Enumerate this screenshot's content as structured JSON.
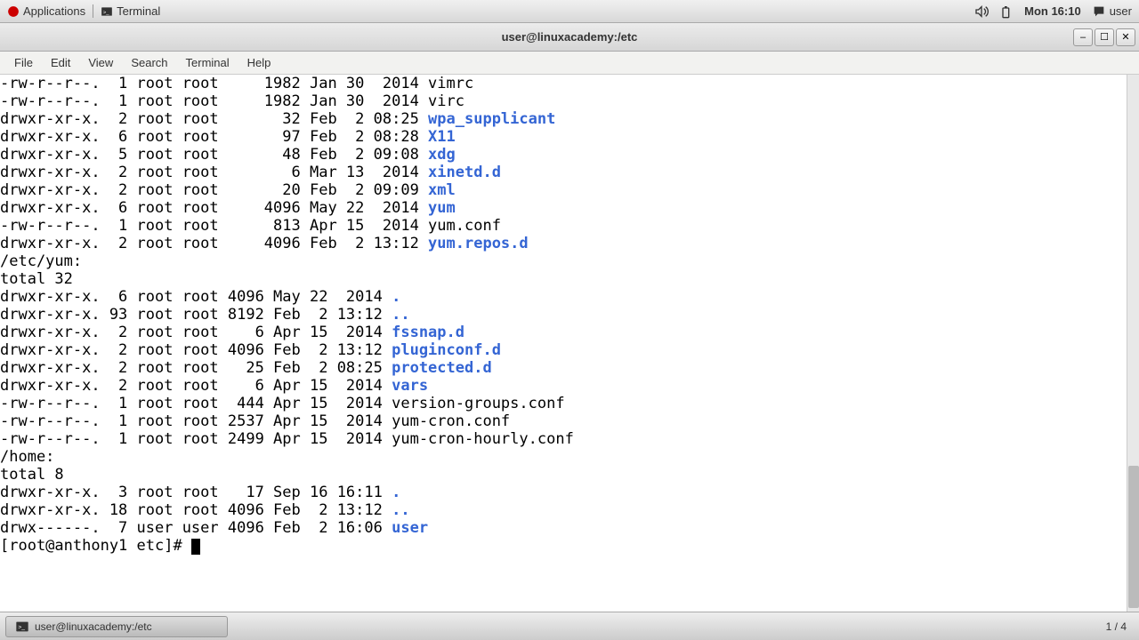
{
  "top_panel": {
    "applications": "Applications",
    "terminal_tab": "Terminal",
    "datetime": "Mon 16:10",
    "user": "user"
  },
  "window": {
    "title": "user@linuxacademy:/etc"
  },
  "menubar": {
    "file": "File",
    "edit": "Edit",
    "view": "View",
    "search": "Search",
    "terminal": "Terminal",
    "help": "Help"
  },
  "terminal_output": {
    "etc_listing": [
      {
        "pre": "-rw-r--r--.  1 root root     1982 Jan 30  2014 ",
        "name": "vimrc",
        "is_dir": false
      },
      {
        "pre": "-rw-r--r--.  1 root root     1982 Jan 30  2014 ",
        "name": "virc",
        "is_dir": false
      },
      {
        "pre": "drwxr-xr-x.  2 root root       32 Feb  2 08:25 ",
        "name": "wpa_supplicant",
        "is_dir": true
      },
      {
        "pre": "drwxr-xr-x.  6 root root       97 Feb  2 08:28 ",
        "name": "X11",
        "is_dir": true
      },
      {
        "pre": "drwxr-xr-x.  5 root root       48 Feb  2 09:08 ",
        "name": "xdg",
        "is_dir": true
      },
      {
        "pre": "drwxr-xr-x.  2 root root        6 Mar 13  2014 ",
        "name": "xinetd.d",
        "is_dir": true
      },
      {
        "pre": "drwxr-xr-x.  2 root root       20 Feb  2 09:09 ",
        "name": "xml",
        "is_dir": true
      },
      {
        "pre": "drwxr-xr-x.  6 root root     4096 May 22  2014 ",
        "name": "yum",
        "is_dir": true
      },
      {
        "pre": "-rw-r--r--.  1 root root      813 Apr 15  2014 ",
        "name": "yum.conf",
        "is_dir": false
      },
      {
        "pre": "drwxr-xr-x.  2 root root     4096 Feb  2 13:12 ",
        "name": "yum.repos.d",
        "is_dir": true
      }
    ],
    "yum_header": "/etc/yum:",
    "yum_total": "total 32",
    "yum_listing": [
      {
        "pre": "drwxr-xr-x.  6 root root 4096 May 22  2014 ",
        "name": ".",
        "is_dir": true
      },
      {
        "pre": "drwxr-xr-x. 93 root root 8192 Feb  2 13:12 ",
        "name": "..",
        "is_dir": true
      },
      {
        "pre": "drwxr-xr-x.  2 root root    6 Apr 15  2014 ",
        "name": "fssnap.d",
        "is_dir": true
      },
      {
        "pre": "drwxr-xr-x.  2 root root 4096 Feb  2 13:12 ",
        "name": "pluginconf.d",
        "is_dir": true
      },
      {
        "pre": "drwxr-xr-x.  2 root root   25 Feb  2 08:25 ",
        "name": "protected.d",
        "is_dir": true
      },
      {
        "pre": "drwxr-xr-x.  2 root root    6 Apr 15  2014 ",
        "name": "vars",
        "is_dir": true
      },
      {
        "pre": "-rw-r--r--.  1 root root  444 Apr 15  2014 ",
        "name": "version-groups.conf",
        "is_dir": false
      },
      {
        "pre": "-rw-r--r--.  1 root root 2537 Apr 15  2014 ",
        "name": "yum-cron.conf",
        "is_dir": false
      },
      {
        "pre": "-rw-r--r--.  1 root root 2499 Apr 15  2014 ",
        "name": "yum-cron-hourly.conf",
        "is_dir": false
      }
    ],
    "home_header": "/home:",
    "home_total": "total 8",
    "home_listing": [
      {
        "pre": "drwxr-xr-x.  3 root root   17 Sep 16 16:11 ",
        "name": ".",
        "is_dir": true
      },
      {
        "pre": "drwxr-xr-x. 18 root root 4096 Feb  2 13:12 ",
        "name": "..",
        "is_dir": true
      },
      {
        "pre": "drwx------.  7 user user 4096 Feb  2 16:06 ",
        "name": "user",
        "is_dir": true
      }
    ],
    "prompt": "[root@anthony1 etc]# "
  },
  "taskbar": {
    "item1": "user@linuxacademy:/etc",
    "workspace": "1 / 4"
  }
}
